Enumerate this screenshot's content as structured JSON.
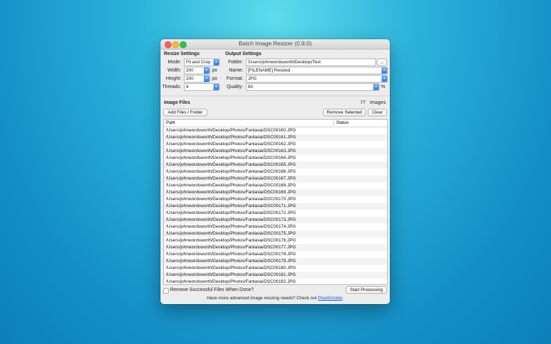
{
  "window": {
    "title": "Batch Image Resizer (0.8.0)"
  },
  "resize": {
    "heading": "Resize Settings",
    "mode_label": "Mode:",
    "mode_value": "Fit and Crop",
    "width_label": "Width:",
    "width_value": "200",
    "width_unit": "px",
    "height_label": "Height:",
    "height_value": "200",
    "height_unit": "px",
    "threads_label": "Threads:",
    "threads_value": "4"
  },
  "output": {
    "heading": "Output Settings",
    "folder_label": "Folder:",
    "folder_value": "/Users/johnwordsworth/Desktop/Test",
    "browse_label": "...",
    "name_label": "Name:",
    "name_value": "[FILENAME] Resized",
    "format_label": "Format:",
    "format_value": "JPG",
    "quality_label": "Quality:",
    "quality_value": "80",
    "quality_unit": "%"
  },
  "files": {
    "heading": "Image Files",
    "count": "77",
    "count_unit": "Images",
    "add_label": "Add Files / Folder",
    "remove_label": "Remove Selected",
    "clear_label": "Clear",
    "col_path": "Path",
    "col_status": "Status",
    "rows": [
      "/Users/johnwordsworth/Desktop/Photos/Fantasia/DSC00160.JPG",
      "/Users/johnwordsworth/Desktop/Photos/Fantasia/DSC00161.JPG",
      "/Users/johnwordsworth/Desktop/Photos/Fantasia/DSC00162.JPG",
      "/Users/johnwordsworth/Desktop/Photos/Fantasia/DSC00163.JPG",
      "/Users/johnwordsworth/Desktop/Photos/Fantasia/DSC00164.JPG",
      "/Users/johnwordsworth/Desktop/Photos/Fantasia/DSC00165.JPG",
      "/Users/johnwordsworth/Desktop/Photos/Fantasia/DSC00166.JPG",
      "/Users/johnwordsworth/Desktop/Photos/Fantasia/DSC00167.JPG",
      "/Users/johnwordsworth/Desktop/Photos/Fantasia/DSC00168.JPG",
      "/Users/johnwordsworth/Desktop/Photos/Fantasia/DSC00169.JPG",
      "/Users/johnwordsworth/Desktop/Photos/Fantasia/DSC00170.JPG",
      "/Users/johnwordsworth/Desktop/Photos/Fantasia/DSC00171.JPG",
      "/Users/johnwordsworth/Desktop/Photos/Fantasia/DSC00172.JPG",
      "/Users/johnwordsworth/Desktop/Photos/Fantasia/DSC00173.JPG",
      "/Users/johnwordsworth/Desktop/Photos/Fantasia/DSC00174.JPG",
      "/Users/johnwordsworth/Desktop/Photos/Fantasia/DSC00175.JPG",
      "/Users/johnwordsworth/Desktop/Photos/Fantasia/DSC00176.JPG",
      "/Users/johnwordsworth/Desktop/Photos/Fantasia/DSC00177.JPG",
      "/Users/johnwordsworth/Desktop/Photos/Fantasia/DSC00178.JPG",
      "/Users/johnwordsworth/Desktop/Photos/Fantasia/DSC00179.JPG",
      "/Users/johnwordsworth/Desktop/Photos/Fantasia/DSC00180.JPG",
      "/Users/johnwordsworth/Desktop/Photos/Fantasia/DSC00181.JPG",
      "/Users/johnwordsworth/Desktop/Photos/Fantasia/DSC00182.JPG"
    ]
  },
  "footer": {
    "remove_successful_label": "Remove Successful Files When Done?",
    "start_label": "Start Processing",
    "note_text": "Have more advanced image resizing needs? Check out ",
    "note_link": "PixelGrinder",
    "note_end": "."
  },
  "colors": {
    "accent": "#2f7fe8",
    "link": "#1a55e0"
  }
}
